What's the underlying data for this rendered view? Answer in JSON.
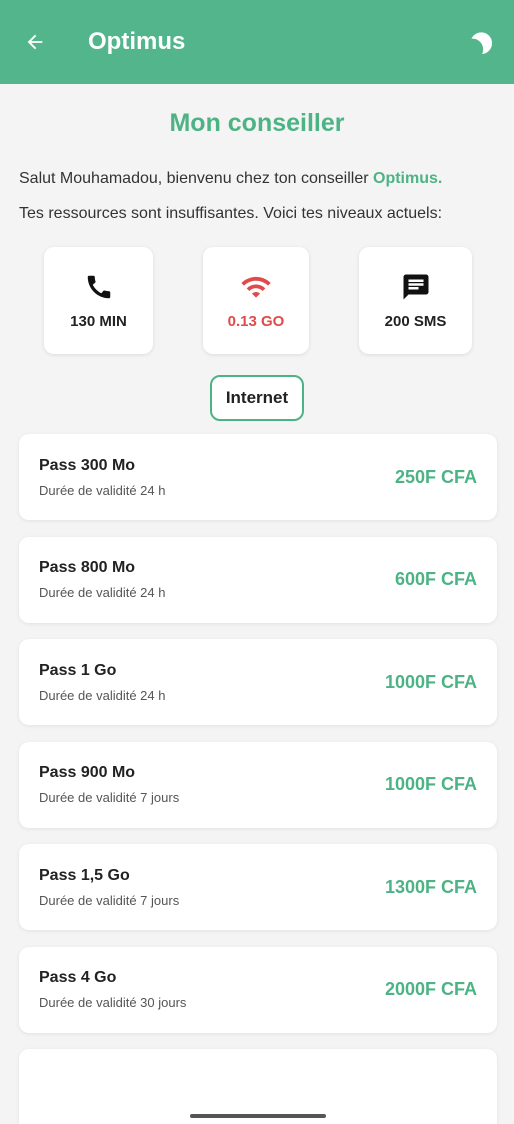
{
  "appbar": {
    "title": "Optimus",
    "back_icon": "arrow-left-icon",
    "theme_icon": "dark-mode-icon"
  },
  "page_title": "Mon conseiller",
  "greeting": {
    "text": "Salut Mouhamadou, bienvenu chez ton conseiller ",
    "brand": "Optimus."
  },
  "info_text": "Tes ressources sont insuffisantes. Voici tes niveaux actuels:",
  "stats": [
    {
      "icon": "phone-icon",
      "value": "130 MIN",
      "status": "ok"
    },
    {
      "icon": "wifi-icon",
      "value": "0.13 GO",
      "status": "low"
    },
    {
      "icon": "message-icon",
      "value": "200 SMS",
      "status": "ok"
    }
  ],
  "filter": {
    "label": "Internet"
  },
  "passes": [
    {
      "name": "Pass 300 Mo",
      "validity": "Durée de validité 24 h",
      "price": "250F CFA"
    },
    {
      "name": "Pass 800 Mo",
      "validity": "Durée de validité 24 h",
      "price": "600F CFA"
    },
    {
      "name": "Pass 1 Go",
      "validity": "Durée de validité 24 h",
      "price": "1000F CFA"
    },
    {
      "name": "Pass 900 Mo",
      "validity": "Durée de validité 7 jours",
      "price": "1000F CFA"
    },
    {
      "name": "Pass 1,5 Go",
      "validity": "Durée de validité 7 jours",
      "price": "1300F CFA"
    },
    {
      "name": "Pass 4 Go",
      "validity": "Durée de validité 30 jours",
      "price": "2000F CFA"
    },
    {
      "name": "",
      "validity": "",
      "price": ""
    }
  ],
  "colors": {
    "accent": "#53b58c",
    "low": "#e14a4a",
    "background": "#f4f4f4"
  }
}
